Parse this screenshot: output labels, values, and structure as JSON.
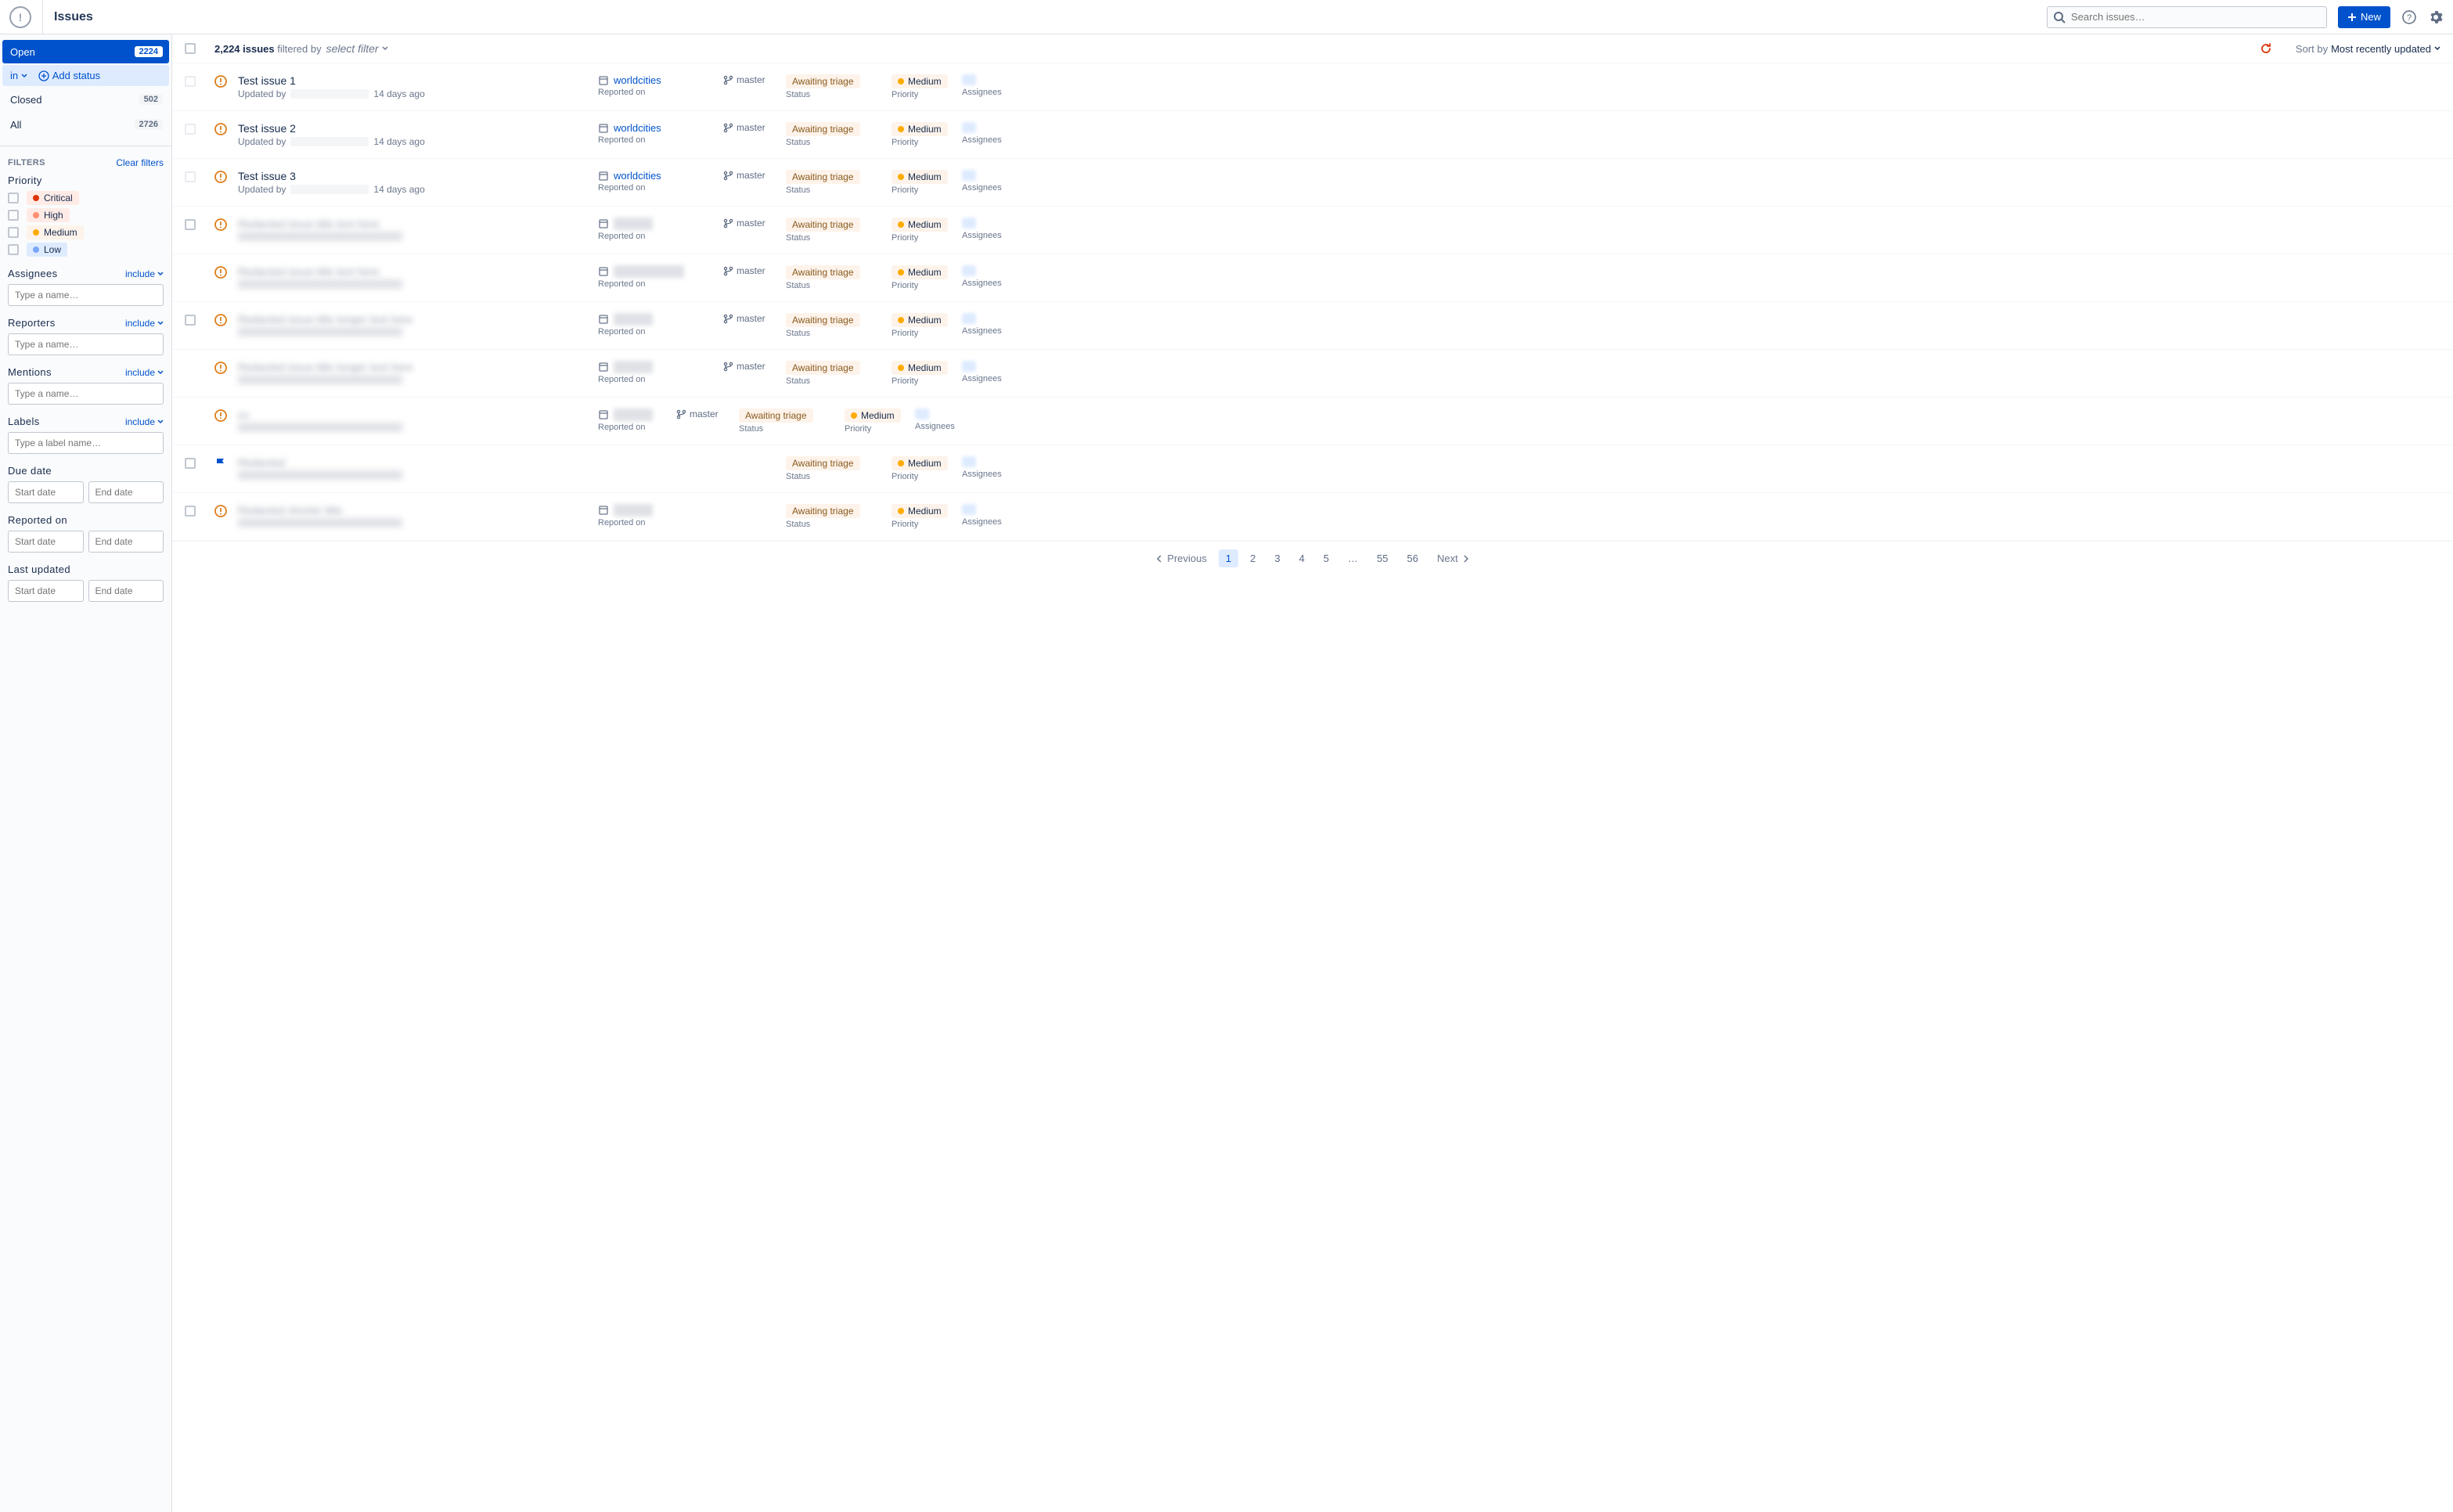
{
  "header": {
    "title": "Issues",
    "search_placeholder": "Search issues…",
    "new_button": "New"
  },
  "sidebar": {
    "statuses": [
      {
        "label": "Open",
        "count": "2224",
        "active": true
      },
      {
        "label": "Closed",
        "count": "502",
        "active": false
      },
      {
        "label": "All",
        "count": "2726",
        "active": false
      }
    ],
    "sub_status": {
      "in_label": "in",
      "add_label": "Add status"
    },
    "filters_title": "Filters",
    "clear_filters": "Clear filters",
    "priority": {
      "title": "Priority",
      "options": [
        {
          "label": "Critical",
          "bg": "#ffebe6",
          "dot": "#de350b"
        },
        {
          "label": "High",
          "bg": "#ffebe6",
          "dot": "#ff8f73"
        },
        {
          "label": "Medium",
          "bg": "#fdf3ea",
          "dot": "#ffab00"
        },
        {
          "label": "Low",
          "bg": "#deebff",
          "dot": "#79a6f6"
        }
      ]
    },
    "assignees": {
      "title": "Assignees",
      "mode": "include",
      "placeholder": "Type a name…"
    },
    "reporters": {
      "title": "Reporters",
      "mode": "include",
      "placeholder": "Type a name…"
    },
    "mentions": {
      "title": "Mentions",
      "mode": "include",
      "placeholder": "Type a name…"
    },
    "labels": {
      "title": "Labels",
      "mode": "include",
      "placeholder": "Type a label name…"
    },
    "due_date": {
      "title": "Due date",
      "start": "Start date",
      "end": "End date"
    },
    "reported_on": {
      "title": "Reported on",
      "start": "Start date",
      "end": "End date"
    },
    "last_updated": {
      "title": "Last updated",
      "start": "Start date",
      "end": "End date"
    }
  },
  "list": {
    "count": "2,224 issues",
    "filtered_by": "filtered by",
    "select_filter": "select filter",
    "sort_by": "Sort by",
    "sort_value": "Most recently updated",
    "status_label": "Status",
    "priority_label": "Priority",
    "assignees_label": "Assignees",
    "reported_on_label": "Reported on",
    "issues": [
      {
        "title": "Test issue 1",
        "updated": "14 days ago",
        "repo": "worldcities",
        "branch": "master",
        "status": "Awaiting triage",
        "priority": "Medium",
        "blurred": false,
        "has_branch": true,
        "has_repo": true,
        "icon": "alert",
        "cb_dim": true
      },
      {
        "title": "Test issue 2",
        "updated": "14 days ago",
        "repo": "worldcities",
        "branch": "master",
        "status": "Awaiting triage",
        "priority": "Medium",
        "blurred": false,
        "has_branch": true,
        "has_repo": true,
        "icon": "alert",
        "cb_dim": true
      },
      {
        "title": "Test issue 3",
        "updated": "14 days ago",
        "repo": "worldcities",
        "branch": "master",
        "status": "Awaiting triage",
        "priority": "Medium",
        "blurred": false,
        "has_branch": true,
        "has_repo": true,
        "icon": "alert",
        "cb_dim": true
      },
      {
        "title": "Redacted issue title text here",
        "updated": "",
        "repo": "",
        "branch": "master",
        "status": "Awaiting triage",
        "priority": "Medium",
        "blurred": true,
        "has_branch": true,
        "has_repo": true,
        "icon": "alert",
        "cb_dim": false
      },
      {
        "title": "Redacted issue title text here",
        "updated": "",
        "repo": "",
        "branch": "master",
        "status": "Awaiting triage",
        "priority": "Medium",
        "blurred": true,
        "has_branch": true,
        "has_repo": true,
        "icon": "alert",
        "cb_dim": false,
        "no_cb": true,
        "repo_wide": true
      },
      {
        "title": "Redacted issue title longer text here",
        "updated": "",
        "repo": "",
        "branch": "master",
        "status": "Awaiting triage",
        "priority": "Medium",
        "blurred": true,
        "has_branch": true,
        "has_repo": true,
        "icon": "alert",
        "cb_dim": false
      },
      {
        "title": "Redacted issue title longer text here",
        "updated": "",
        "repo": "",
        "branch": "master",
        "status": "Awaiting triage",
        "priority": "Medium",
        "blurred": true,
        "has_branch": true,
        "has_repo": true,
        "icon": "alert",
        "cb_dim": false,
        "no_cb": true
      },
      {
        "title": "xx",
        "updated": "",
        "repo": "",
        "branch": "master",
        "status": "Awaiting triage",
        "priority": "Medium",
        "blurred": true,
        "has_branch": true,
        "has_repo": true,
        "icon": "alert",
        "cb_dim": false,
        "no_cb": true,
        "branch_offset": true
      },
      {
        "title": "Redacted",
        "updated": "",
        "repo": "",
        "branch": "",
        "status": "Awaiting triage",
        "priority": "Medium",
        "blurred": true,
        "has_branch": false,
        "has_repo": false,
        "icon": "flag",
        "cb_dim": false
      },
      {
        "title": "Redacted shorter title",
        "updated": "",
        "repo": "",
        "branch": "",
        "status": "Awaiting triage",
        "priority": "Medium",
        "blurred": true,
        "has_branch": false,
        "has_repo": true,
        "icon": "alert",
        "cb_dim": false
      }
    ]
  },
  "pagination": {
    "prev": "Previous",
    "pages": [
      "1",
      "2",
      "3",
      "4",
      "5",
      "…",
      "55",
      "56"
    ],
    "next": "Next",
    "active": "1"
  }
}
